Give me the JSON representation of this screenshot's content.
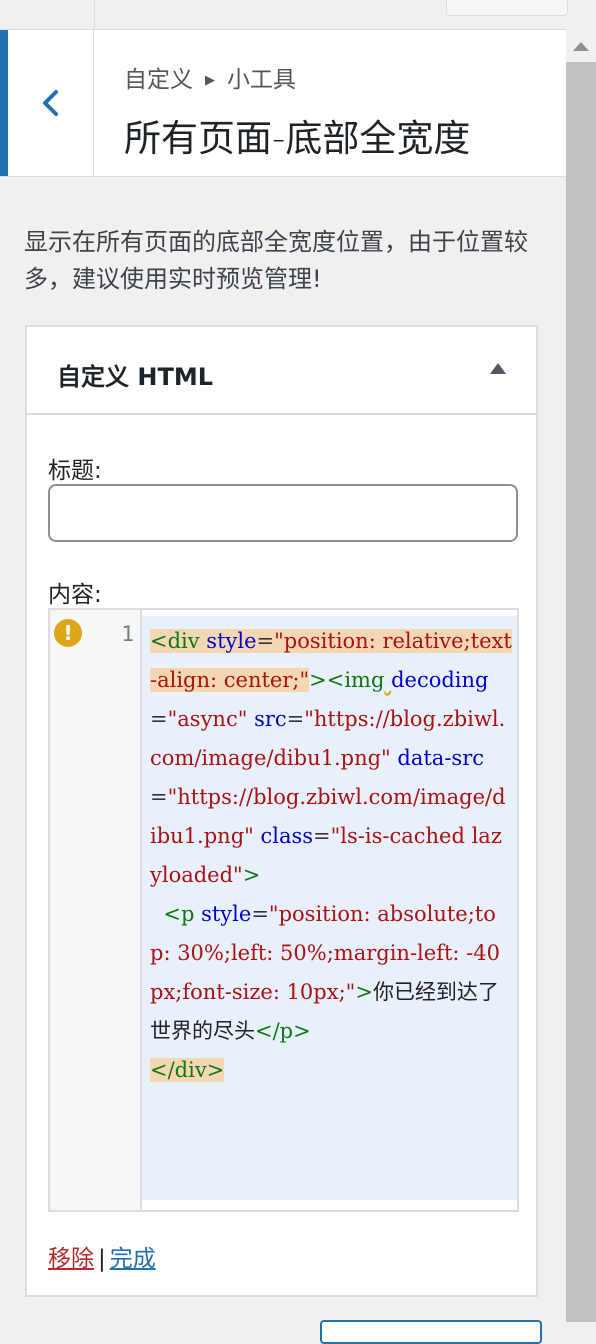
{
  "header": {
    "breadcrumb_root": "自定义",
    "breadcrumb_child": "小工具",
    "title": "所有页面-底部全宽度",
    "back_icon": "chevron-left-icon"
  },
  "section": {
    "description": "显示在所有页面的底部全宽度位置，由于位置较多，建议使用实时预览管理!"
  },
  "widget": {
    "title_strong": "自定义",
    "title_rest": " HTML",
    "toggle_icon": "triangle-up-icon",
    "title_label": "标题:",
    "title_value": "",
    "content_label": "内容:",
    "line_number": "1",
    "lint_icon": "warning-icon",
    "lint_glyph": "!",
    "code": {
      "t1": "<div",
      "a1": " style",
      "e1": "=",
      "s1": "\"position: relative;text-align: center;\"",
      "t2": "><img",
      "a2": "decoding",
      "e2": "=",
      "s2": "\"async\"",
      "a3": "src",
      "e3": "=",
      "s3": "\"https://blog.zbiwl.com/image/dibu1.png\"",
      "a4": " data-src",
      "e4": "=",
      "s4": "\"https://blog.zbiwl.com/image/dibu1.png\"",
      "a5": " class",
      "e5": "=",
      "s5": "\"ls-is-cached lazyloaded\"",
      "t3": ">",
      "indent": "  ",
      "t4": "<p",
      "a6": " style",
      "e6": "=",
      "s6": "\"position: absolute;top: 30%;left: 50%;margin-left: -40px;font-size: 10px;\"",
      "t5": ">",
      "text": "你已经到达了世界的尽头",
      "t6": "</p>",
      "t7": "</div>"
    },
    "remove_label": "移除",
    "separator": "|",
    "done_label": "完成"
  },
  "colors": {
    "accent": "#2271b1",
    "remove": "#b32d2e",
    "warning": "#dba617"
  }
}
